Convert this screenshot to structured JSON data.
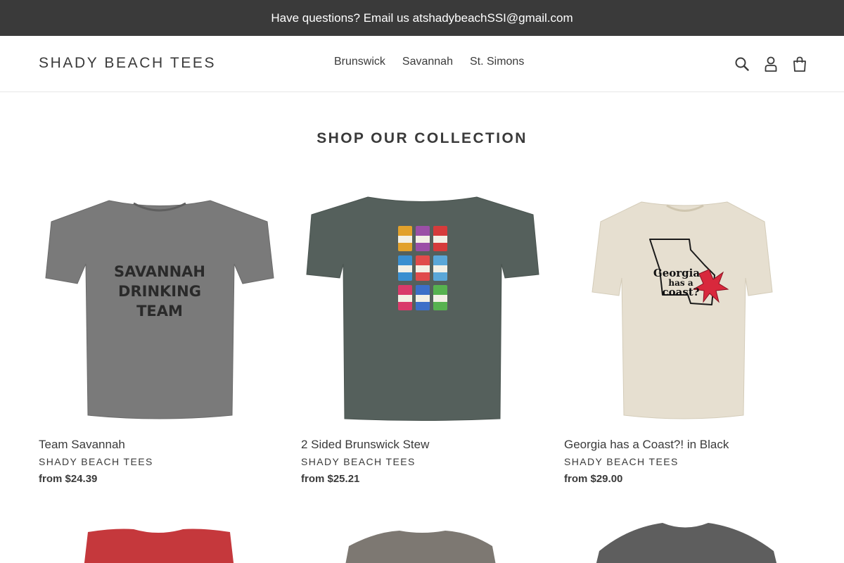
{
  "announcement": {
    "prefix": "Have questions? Email us at ",
    "email": "shadybeachSSI@gmail.com"
  },
  "header": {
    "logo": "SHADY BEACH TEES",
    "nav": [
      {
        "label": "Brunswick"
      },
      {
        "label": "Savannah"
      },
      {
        "label": "St. Simons"
      }
    ],
    "icons": [
      "search-icon",
      "account-icon",
      "cart-icon"
    ]
  },
  "collection": {
    "title": "SHOP OUR COLLECTION",
    "products": [
      {
        "title": "Team Savannah",
        "vendor": "SHADY BEACH TEES",
        "price": "from $24.39",
        "shirt_color": "#7a7a7a",
        "print_lines": [
          "SAVANNAH",
          "DRINKING",
          "TEAM"
        ]
      },
      {
        "title": "2 Sided Brunswick Stew",
        "vendor": "SHADY BEACH TEES",
        "price": "from $25.21",
        "shirt_color": "#55605c"
      },
      {
        "title": "Georgia has a Coast?! in Black",
        "vendor": "SHADY BEACH TEES",
        "price": "from $29.00",
        "shirt_color": "#e6dfd0",
        "print_lines": [
          "Georgia",
          "has a",
          "coast?"
        ]
      }
    ],
    "next_row_shirt_colors": [
      "#c5383c",
      "#7d7872",
      "#5e5e5e"
    ]
  },
  "colors": {
    "announcement_bg": "#3a3a3a",
    "text": "#3a3a3a"
  }
}
